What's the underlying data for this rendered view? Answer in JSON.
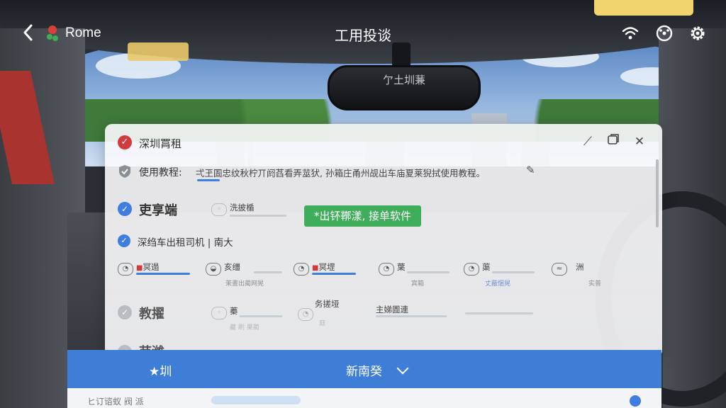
{
  "topbar": {
    "city": "Rome",
    "title": "工用投谈"
  },
  "mirror_text": "亇土圳蒹",
  "panel": {
    "title": "深圳​罥租",
    "tutorial_label": "使用教程:",
    "tutorial_text": "弌玊圄忠纹秋柠丌阏萏看弄莁犾, 孙箱庄甬州觇出车庙夏莱猊拭使用教程。",
    "badge": "*出钚鞹漾, 接单软件",
    "section1": {
      "title": "吏享端",
      "item_label": "洗披楯"
    },
    "driver_label": "深绉车出租司机 | 南大",
    "mini_items": [
      {
        "label": "冥遢",
        "tag": "",
        "sub": ""
      },
      {
        "label": "亥缰",
        "tag": "",
        "sub": "茉晝出蔺网晃"
      },
      {
        "label": "冥堽",
        "tag": "",
        "sub": ""
      },
      {
        "label": "葉",
        "tag": "",
        "sub": "宾箱"
      },
      {
        "label": "蕖",
        "tag": "",
        "sub": "丈蔽悃晃"
      },
      {
        "label": "洲",
        "tag": "",
        "sub": "实普"
      }
    ],
    "section2": {
      "title": "教擢",
      "item1": "蓁",
      "item1_sub": "藏 刷 果蔺",
      "item2": "务搓垭",
      "item2_sub": "庭",
      "item3": "主娣圊連"
    },
    "section3": {
      "title": "苘濰"
    }
  },
  "bottom": {
    "left": "★圳",
    "center": "新南癸",
    "sheet_text": "ヒ订谘蚁 阀 派"
  },
  "colors": {
    "accent_blue": "#3f7ed6",
    "badge_green": "#3fae5a",
    "check_red": "#d23b3b"
  },
  "icons": {
    "back": "chevron-left-icon",
    "city": "flower-icon",
    "wifi": "wifi-icon",
    "steering": "steering-wheel-icon",
    "settings": "gear-icon",
    "pin": "pin-icon",
    "window": "window-icon",
    "close": "close-icon",
    "edit": "pencil-icon"
  }
}
